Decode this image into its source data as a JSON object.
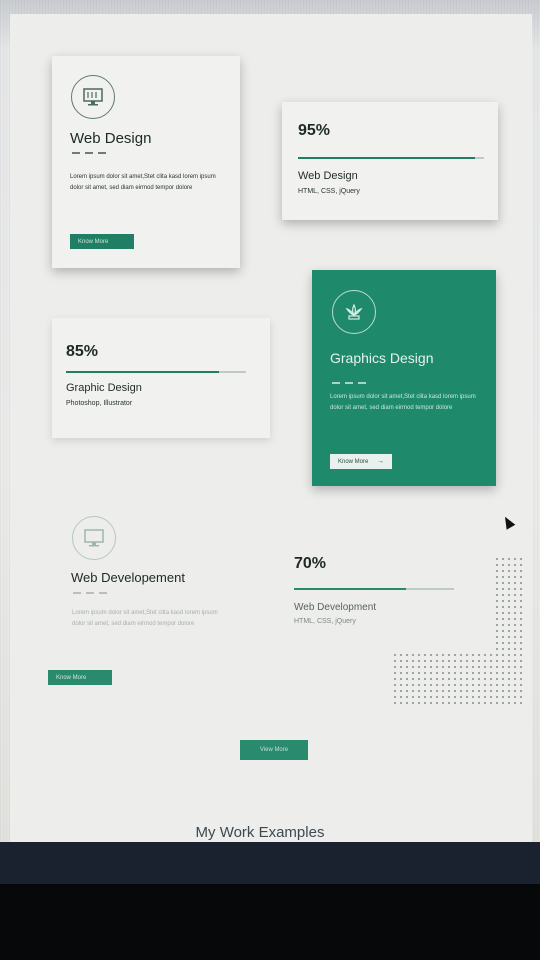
{
  "cards": {
    "web_design": {
      "title": "Web Design",
      "text": "Lorem ipsum dolor sit amet,Stet clita kasd lorem ipsum dolor sit amet, sed diam  eirmod tempor dolore",
      "button": "Know More",
      "icon": "monitor-icon"
    },
    "graphics_design": {
      "title": "Graphics Design",
      "text": "Lorem ipsum dolor sit amet,Stet clita kasd lorem ipsum dolor sit amet, sed diam  eirmod tempor dolore",
      "button": "Know More",
      "arrow": "→",
      "icon": "flower-icon"
    },
    "web_development": {
      "title": "Web Developement",
      "text": "Lorem ipsum dolor sit amet,Stet clita kasd lorem ipsum dolor sit amet, sed diam  eirmod tempor dolore",
      "button": "Know More",
      "icon": "monitor-icon"
    }
  },
  "skills": [
    {
      "percent": "95%",
      "value": 0.95,
      "name": "Web Design",
      "tools": "HTML, CSS, jQuery"
    },
    {
      "percent": "85%",
      "value": 0.85,
      "name": "Graphic Design",
      "tools": "Photoshop, Illustrator"
    },
    {
      "percent": "70%",
      "value": 0.7,
      "name": "Web Development",
      "tools": "HTML, CSS, jQuery"
    }
  ],
  "view_more": "View More",
  "section_heading": "My Work Examples",
  "colors": {
    "accent": "#1f7e64",
    "green_card": "#1f8a6b"
  }
}
